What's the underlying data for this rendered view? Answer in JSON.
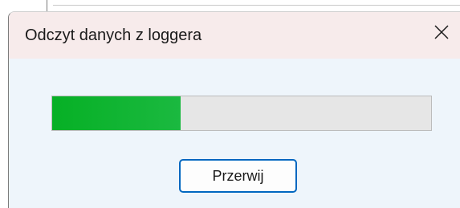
{
  "dialog": {
    "title": "Odczyt danych z loggera",
    "close_icon": "close-icon",
    "progress": {
      "fraction": 0.34,
      "fill_color": "#06b025",
      "track_color": "#e6e6e6"
    },
    "abort_label": "Przerwij",
    "accent_color": "#0067c0"
  }
}
